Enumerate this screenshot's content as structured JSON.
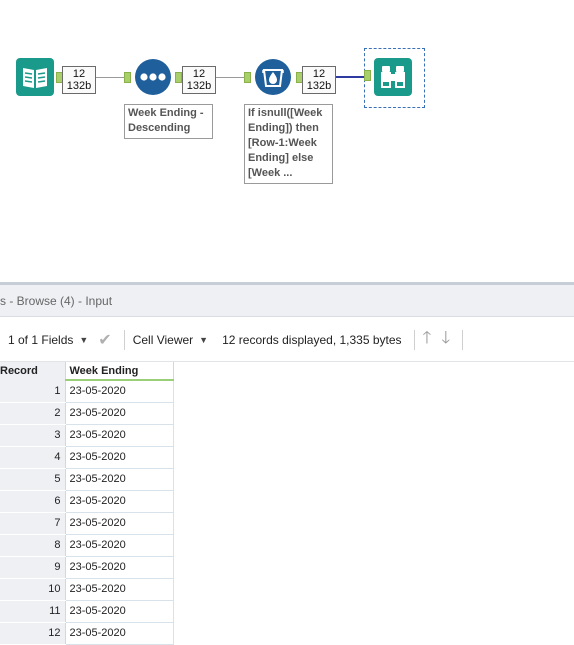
{
  "canvas": {
    "tools": [
      {
        "name": "input-data-icon"
      },
      {
        "name": "sort-icon"
      },
      {
        "name": "formula-icon"
      },
      {
        "name": "browse-icon"
      }
    ],
    "badges": [
      {
        "records": "12",
        "size": "132b"
      },
      {
        "records": "12",
        "size": "132b"
      },
      {
        "records": "12",
        "size": "132b"
      }
    ],
    "annotations": {
      "sort": "Week Ending -\nDescending",
      "formula": "If isnull([Week\nEnding]) then\n[Row-1:Week\nEnding] else\n[Week ..."
    },
    "colors": {
      "teal": "#1a9a8a",
      "blue": "#1f5f9c",
      "active_connection": "#2f3aa0"
    }
  },
  "results": {
    "title": "s - Browse (4) - Input",
    "fields_label": "1 of 1 Fields",
    "viewer_label": "Cell Viewer",
    "records_info": "12 records displayed, 1,335 bytes",
    "columns": [
      "Record",
      "Week Ending"
    ],
    "rows": [
      {
        "record": "1",
        "value": "23-05-2020"
      },
      {
        "record": "2",
        "value": "23-05-2020"
      },
      {
        "record": "3",
        "value": "23-05-2020"
      },
      {
        "record": "4",
        "value": "23-05-2020"
      },
      {
        "record": "5",
        "value": "23-05-2020"
      },
      {
        "record": "6",
        "value": "23-05-2020"
      },
      {
        "record": "7",
        "value": "23-05-2020"
      },
      {
        "record": "8",
        "value": "23-05-2020"
      },
      {
        "record": "9",
        "value": "23-05-2020"
      },
      {
        "record": "10",
        "value": "23-05-2020"
      },
      {
        "record": "11",
        "value": "23-05-2020"
      },
      {
        "record": "12",
        "value": "23-05-2020"
      }
    ]
  }
}
